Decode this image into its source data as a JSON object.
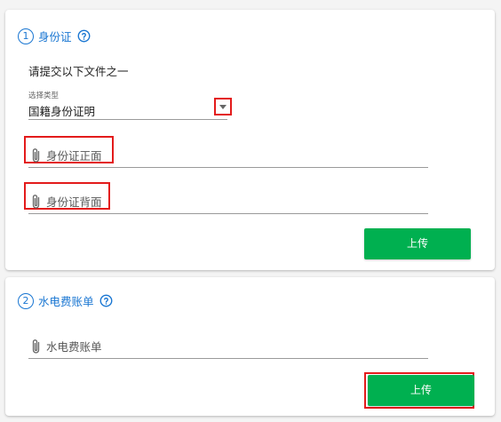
{
  "section1": {
    "step": "1",
    "title": "身份证",
    "help_icon": "question-circle-icon",
    "instruction": "请提交以下文件之一",
    "select": {
      "label": "选择类型",
      "value": "国籍身份证明"
    },
    "file_front": {
      "placeholder": "身份证正面",
      "icon": "paperclip-icon"
    },
    "file_back": {
      "placeholder": "身份证背面",
      "icon": "paperclip-icon"
    },
    "upload_label": "上传"
  },
  "section2": {
    "step": "2",
    "title": "水电费账单",
    "help_icon": "question-circle-icon",
    "file": {
      "placeholder": "水电费账单",
      "icon": "paperclip-icon"
    },
    "upload_label": "上传"
  },
  "colors": {
    "accent": "#1976d2",
    "upload_button": "#00b050",
    "highlight": "#e31b1b"
  }
}
